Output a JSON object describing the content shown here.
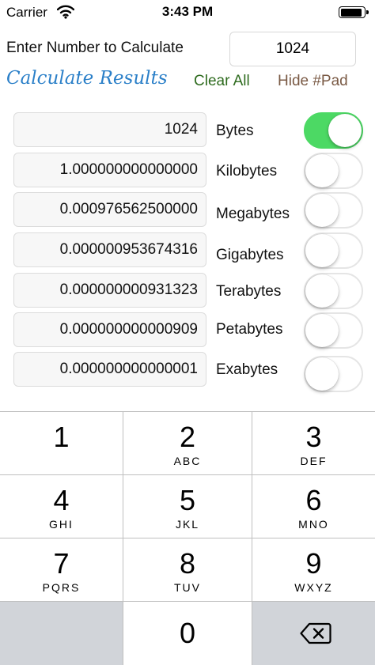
{
  "status_bar": {
    "carrier": "Carrier",
    "time": "3:43 PM",
    "battery_level": 0.92
  },
  "input": {
    "label": "Enter Number to Calculate",
    "value": "1024"
  },
  "actions": {
    "calculate": "Calculate Results",
    "clear": "Clear All",
    "hide_pad": "Hide #Pad"
  },
  "results": [
    {
      "value": "1024",
      "unit": "Bytes",
      "toggle_on": true
    },
    {
      "value": "1.000000000000000",
      "unit": "Kilobytes",
      "toggle_on": false
    },
    {
      "value": "0.000976562500000",
      "unit": "Megabytes",
      "toggle_on": false
    },
    {
      "value": "0.000000953674316",
      "unit": "Gigabytes",
      "toggle_on": false
    },
    {
      "value": "0.000000000931323",
      "unit": "Terabytes",
      "toggle_on": false
    },
    {
      "value": "0.000000000000909",
      "unit": "Petabytes",
      "toggle_on": false
    },
    {
      "value": "0.000000000000001",
      "unit": "Exabytes",
      "toggle_on": false
    }
  ],
  "keypad": {
    "keys": [
      {
        "digit": "1",
        "letters": ""
      },
      {
        "digit": "2",
        "letters": "ABC"
      },
      {
        "digit": "3",
        "letters": "DEF"
      },
      {
        "digit": "4",
        "letters": "GHI"
      },
      {
        "digit": "5",
        "letters": "JKL"
      },
      {
        "digit": "6",
        "letters": "MNO"
      },
      {
        "digit": "7",
        "letters": "PQRS"
      },
      {
        "digit": "8",
        "letters": "TUV"
      },
      {
        "digit": "9",
        "letters": "WXYZ"
      }
    ],
    "zero": "0"
  },
  "colors": {
    "toggle_on": "#4cd964",
    "calculate_link": "#2a7fc8",
    "clear_link": "#2e6b1e",
    "hide_link": "#7a5a45",
    "keypad_gray": "#d1d4d9"
  },
  "icons": {
    "wifi": "wifi-icon",
    "battery": "battery-icon",
    "delete": "backspace-icon"
  }
}
